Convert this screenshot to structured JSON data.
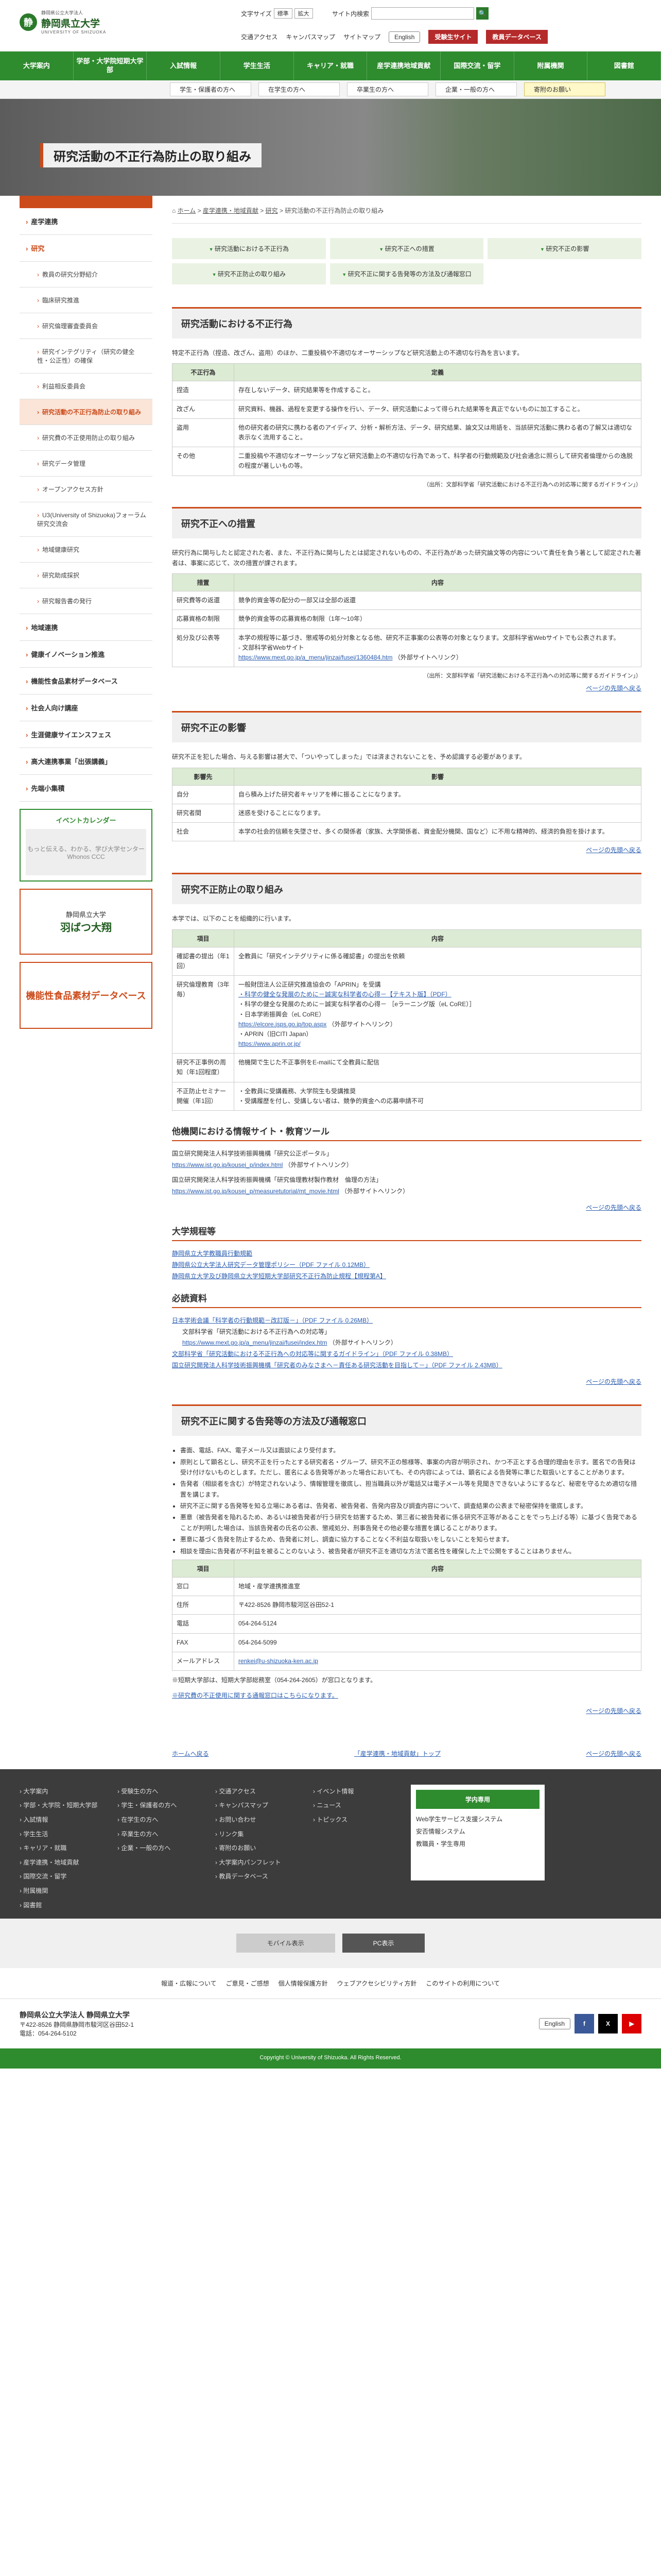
{
  "header": {
    "logo_small": "静岡県公立大学法人",
    "logo_name": "静岡県立大学",
    "logo_en": "UNIVERSITY OF SHIZUOKA",
    "font_label": "文字サイズ",
    "font_normal": "標準",
    "font_large": "拡大",
    "search_label": "サイト内検索",
    "search_placeholder": "",
    "search_btn": "🔍",
    "util": [
      "交通アクセス",
      "キャンパスマップ",
      "サイトマップ"
    ],
    "english": "English",
    "btn1": "受験生サイト",
    "btn2": "教員データベース"
  },
  "nav": [
    "大学案内",
    "学部・大学院短期大学部",
    "入試情報",
    "学生生活",
    "キャリア・就職",
    "産学連携地域貢献",
    "国際交流・留学",
    "附属機関",
    "図書館"
  ],
  "subnav": [
    "ホーム",
    "学生・保護者の方へ",
    "在学生の方へ",
    "卒業生の方へ",
    "企業・一般の方へ",
    "寄附のお願い"
  ],
  "hero_title": "研究活動の不正行為防止の取り組み",
  "sidebar": {
    "cat": "産学連携・地域貢献",
    "items": [
      {
        "t": "産学連携",
        "c": "l1"
      },
      {
        "t": "研究",
        "c": "l1 act"
      },
      {
        "t": "教員の研究分野紹介",
        "c": "l2"
      },
      {
        "t": "臨床研究推進",
        "c": "l2"
      },
      {
        "t": "研究倫理審査委員会",
        "c": "l2"
      },
      {
        "t": "研究インテグリティ（研究の健全性・公正性）の確保",
        "c": "l2"
      },
      {
        "t": "利益相反委員会",
        "c": "l2"
      },
      {
        "t": "研究活動の不正行為防止の取り組み",
        "c": "l2 sel cur"
      },
      {
        "t": "研究費の不正使用防止の取り組み",
        "c": "l2"
      },
      {
        "t": "研究データ管理",
        "c": "l2"
      },
      {
        "t": "オープンアクセス方針",
        "c": "l2"
      },
      {
        "t": "U3(University of Shizuoka)フォーラム研究交流会",
        "c": "l2"
      },
      {
        "t": "地域健康研究",
        "c": "l2"
      },
      {
        "t": "研究助成採択",
        "c": "l2"
      },
      {
        "t": "研究報告書の発行",
        "c": "l2"
      },
      {
        "t": "地域連携",
        "c": "l1"
      },
      {
        "t": "健康イノベーション推進",
        "c": "l1"
      },
      {
        "t": "機能性食品素材データベース",
        "c": "l1"
      },
      {
        "t": "社会人向け講座",
        "c": "l1"
      },
      {
        "t": "生涯健康サイエンスフェス",
        "c": "l1"
      },
      {
        "t": "高大連携事業「出張講義」",
        "c": "l1"
      },
      {
        "t": "先端小集積",
        "c": "l1"
      }
    ],
    "banner1": "イベントカレンダー",
    "banner1_img": "もっと伝える、わかる、学び大学センター Whonos CCC",
    "banner2_line1": "静岡県立大学",
    "banner2_line2": "羽ばつ大翔",
    "banner3": "機能性食品素材データベース"
  },
  "breadcrumb": [
    "ホーム",
    "産学連携・地域貢献",
    "研究",
    "研究活動の不正行為防止の取り組み"
  ],
  "index": [
    "研究活動における不正行為",
    "研究不正への措置",
    "研究不正の影響",
    "研究不正防止の取り組み",
    "研究不正に関する告発等の方法及び通報窓口"
  ],
  "s1": {
    "title": "研究活動における不正行為",
    "lead": "特定不正行為（捏造、改ざん、盗用）のほか、二重投稿や不適切なオーサーシップなど研究活動上の不適切な行為を言います。",
    "th": [
      "不正行為",
      "定義"
    ],
    "rows": [
      [
        "捏造",
        "存在しないデータ、研究結果等を作成すること。"
      ],
      [
        "改ざん",
        "研究資料、機器、過程を変更する操作を行い、データ、研究活動によって得られた結果等を真正でないものに加工すること。"
      ],
      [
        "盗用",
        "他の研究者の研究に携わる者のアイディア、分析・解析方法、データ、研究結果、論文又は用語を、当該研究活動に携わる者の了解又は適切な表示なく流用すること。"
      ],
      [
        "その他",
        "二重投稿や不適切なオーサーシップなど研究活動上の不適切な行為であって、科学者の行動規範及び社会通念に照らして研究者倫理からの逸脱の程度が著しいもの等。"
      ]
    ],
    "note": "（出所：文部科学省「研究活動における不正行為への対応等に関するガイドライン」）"
  },
  "s2": {
    "title": "研究不正への措置",
    "lead": "研究行為に関与したと認定された者、また、不正行為に関与したとは認定されないものの、不正行為があった研究論文等の内容について責任を負う著として認定された著者は、事案に応じて、次の措置が課されます。",
    "th": [
      "措置",
      "内容"
    ],
    "rows": [
      [
        "研究費等の返還",
        "競争的資金等の配分の一部又は全部の返還"
      ],
      [
        "応募資格の制限",
        "競争的資金等の応募資格の制限（1年〜10年）"
      ]
    ],
    "row3k": "処分及び公表等",
    "row3v": "本学の規程等に基づき、懲戒等の処分対象となる他、研究不正事案の公表等の対象となります。文部科学省Webサイトでも公表されます。",
    "row3l1": "- 文部科学省Webサイト",
    "row3url": "https://www.mext.go.jp/a_menu/jinzai/fusei/1360484.htm",
    "row3ext": "（外部サイトへリンク）",
    "note": "（出所：文部科学省「研究活動における不正行為への対応等に関するガイドライン」）",
    "top": "ページの先頭へ戻る"
  },
  "s3": {
    "title": "研究不正の影響",
    "lead": "研究不正を犯した場合、与える影響は甚大で、「ついやってしまった」では済まされないことを、予め認識する必要があります。",
    "th": [
      "影響先",
      "影響"
    ],
    "rows": [
      [
        "自分",
        "自ら積み上げた研究者キャリアを棒に振ることになります。"
      ],
      [
        "研究者間",
        "迷惑を受けることになります。"
      ],
      [
        "社会",
        "本学の社会的信頼を失墜させ、多くの関係者（家族、大学関係者、資金配分機関、国など）に不用な精神的、経済的負担を掛けます。"
      ]
    ]
  },
  "s4": {
    "title": "研究不正防止の取り組み",
    "lead": "本学では、以下のことを組織的に行います。",
    "th": [
      "項目",
      "内容"
    ],
    "r1k": "確認書の提出（年1回）",
    "r1v": "全教員に「研究インテグリティに係る確認書」の提出を依頼",
    "r2k": "研究倫理教育（3年毎）",
    "r2v1": "一般財団法人公正研究推進協会の「APRIN」を受講",
    "r2a1": "・科学の健全な発展のために－誠実な科学者の心得－【テキスト版】（PDF）",
    "r2v2": "・科学の健全な発展のために－誠実な科学者の心得－ ［eラーニング版（eL CoRE）］",
    "r2v3": "・日本学術振興会（eL CoRE）",
    "r2url": "https://elcore.jsps.go.jp/top.aspx",
    "r2ext": "（外部サイトへリンク）",
    "r2v4": "・APRIN（旧CITI Japan）",
    "r2url2": "https://www.aprin.or.jp/",
    "r3k": "研究不正事例の周知（年1回程度）",
    "r3v": "他機関で生じた不正事例をE-mailにて全教員に配信",
    "r4k": "不正防止セミナー開催（年1回）",
    "r4v1": "・全教員に受講義務、大学院生も受講推奨",
    "r4v2": "・受講履歴を付し、受講しない者は、競争的資金への応募申請不可"
  },
  "s5": {
    "title": "他機関における情報サイト・教育ツール",
    "l1": "国立研究開発法人科学技術振興機構「研究公正ポータル」",
    "u1": "https://www.jst.go.jp/kousei_p/index.html",
    "e1": "（外部サイトへリンク）",
    "l2": "国立研究開発法人科学技術振興機構「研究倫理教材製作教材　倫理の方法」",
    "u2": "https://www.jst.go.jp/kousei_p/measuretutorial/mt_movie.html",
    "e2": "（外部サイトへリンク）"
  },
  "s6": {
    "title": "大学規程等",
    "links": [
      "静岡県立大学教職員行動規範",
      "静岡県公立大学法人研究データ管理ポリシー（PDF ファイル 0.12MB）",
      "静岡県立大学及び静岡県立大学短期大学部研究不正行為防止規程【規程第A】"
    ]
  },
  "s7": {
    "title": "必読資料",
    "a1": "日本学術会議「科学者の行動規範－改訂版－」（PDF ファイル 0.26MB）",
    "t1": "文部科学省「研究活動における不正行為への対応等」",
    "u1": "https://www.mext.go.jp/a_menu/jinzai/fusei/index.htm",
    "e1": "（外部サイトへリンク）",
    "a2": "文部科学省「研究活動における不正行為への対応等に関するガイドライン」（PDF ファイル 0.38MB）",
    "a3": "国立研究開発法人科学技術振興機構「研究者のみなさまへ－責任ある研究活動を目指して－」（PDF ファイル 2.43MB）"
  },
  "s8": {
    "title": "研究不正に関する告発等の方法及び通報窓口",
    "bullets": [
      "書面、電話、FAX、電子メール又は面談により受付ます。",
      "原則として顕名とし、研究不正を行ったとする研究者名・グループ、研究不正の態様等、事案の内容が明示され、かつ不正とする合理的理由を示す。匿名での告発は受け付けないものとします。ただし、匿名による告発等があった場合においても、その内容によっては、顕名による告発等に準じた取扱いとすることがあります。",
      "告発者（相談者を含む）が特定されないよう、情報管理を徹底し、担当職員以外が電話又は電子メール等を見聞きできないようにするなど、秘密を守るため適切な措置を講じます。",
      "研究不正に関する告発等を知る立場にある者は、告発者、被告発者、告発内容及び調査内容について、調査結果の公表まで秘密保持を徹底します。",
      "悪意（被告発者を陥れるため、あるいは被告発者が行う研究を妨害するため、第三者に被告発者に係る研究不正等があることをでっち上げる等）に基づく告発であることが判明した場合は、当該告発者の氏名の公表、懲戒処分、刑事告発その他必要な措置を講じることがあります。",
      "悪意に基づく告発を防止するため、告発者に対し、調査に協力することなく不利益な取扱いをしないことを知らせます。",
      "相談を理由に告発者が不利益を被ることのないよう、被告発者が研究不正を適切な方法で匿名性を確保した上で公開をすることはありません。"
    ],
    "th": [
      "項目",
      "内容"
    ],
    "rows": [
      [
        "窓口",
        "地域・産学連携推進室"
      ],
      [
        "住所",
        "〒422-8526 静岡市駿河区谷田52-1"
      ],
      [
        "電話",
        "054-264-5124"
      ],
      [
        "FAX",
        "054-264-5099"
      ],
      [
        "メールアドレス",
        "renkei@u-shizuoka-ken.ac.jp"
      ]
    ],
    "n1": "※短期大学部は、短期大学部総務室（054-264-2605）が窓口となります。",
    "n2": "※研究費の不正使用に関する通報窓口はこちらになります。"
  },
  "footnav": {
    "back": "ホームへ戻る",
    "parent": "「産学連携・地域貢献」トップ",
    "top": "ページの先頭へ戻る"
  },
  "footer": {
    "c1": [
      "大学案内",
      "学部・大学院・短期大学部",
      "入試情報",
      "学生生活",
      "キャリア・就職",
      "産学連携・地域貢献",
      "国際交流・留学",
      "附属機関",
      "図書館"
    ],
    "c2": [
      "受験生の方へ",
      "学生・保護者の方へ",
      "在学生の方へ",
      "卒業生の方へ",
      "企業・一般の方へ"
    ],
    "c3": [
      "交通アクセス",
      "キャンパスマップ",
      "お問い合わせ",
      "リンク集",
      "寄附のお願い",
      "大学案内パンフレット",
      "教員データベース"
    ],
    "c4": [
      "イベント情報",
      "ニュース",
      "トピックス"
    ],
    "stu_title": "学内専用",
    "stu": [
      "Web学生サービス支援システム",
      "安否情報システム",
      "教職員・学生専用"
    ],
    "mobile": "モバイル表示",
    "pc": "PC表示",
    "links": [
      "報道・広報について",
      "ご意見・ご感想",
      "個人情報保護方針",
      "ウェブアクセシビリティ方針",
      "このサイトの利用について"
    ],
    "org": "静岡県公立大学法人 静岡県立大学",
    "addr": "〒422-8526 静岡県静岡市駿河区谷田52-1",
    "tel": "電話：054-264-5102",
    "eng": "English",
    "copy": "Copyright © University of Shizuoka. All Rights Reserved."
  },
  "colors": {
    "green": "#2e8b2e",
    "orange": "#cc4b1a"
  }
}
